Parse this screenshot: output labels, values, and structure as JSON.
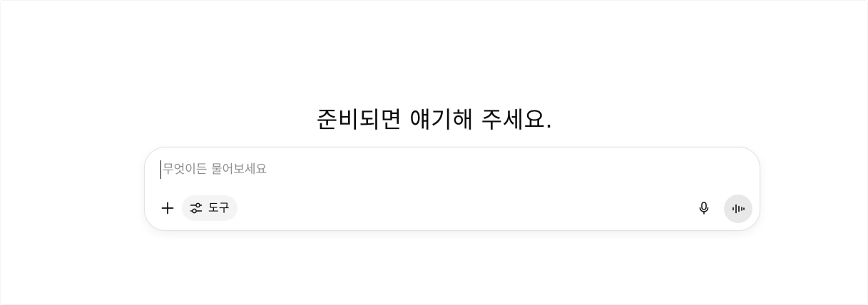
{
  "headline": "준비되면 얘기해 주세요.",
  "composer": {
    "placeholder": "무엇이든 물어보세요",
    "value": "",
    "add_icon": "plus-icon",
    "tools": {
      "icon": "sliders-icon",
      "label": "도구"
    },
    "mic_icon": "microphone-icon",
    "voice_icon": "voice-waveform-icon"
  },
  "colors": {
    "background": "#ffffff",
    "text": "#0d0d0d",
    "placeholder": "#8f8f8f",
    "composer_border": "#e3e3e3",
    "tools_pill_bg": "#f4f4f4",
    "voice_button_bg": "#e8e8e8"
  }
}
